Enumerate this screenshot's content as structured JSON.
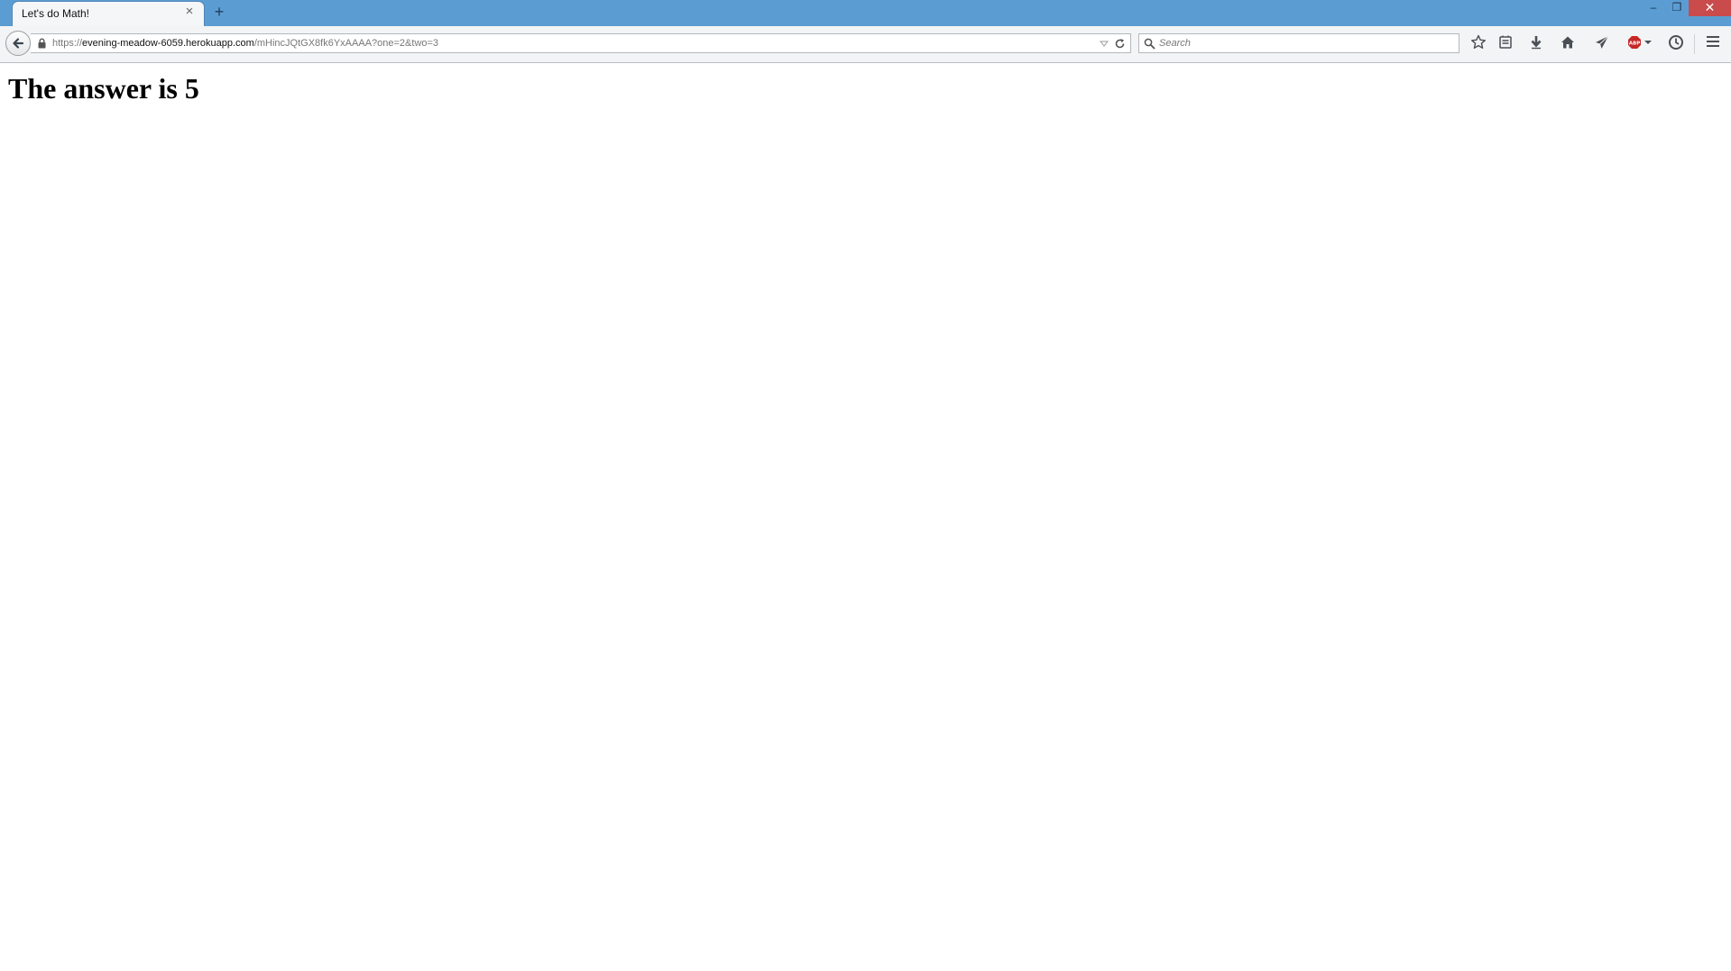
{
  "browser": {
    "tab": {
      "title": "Let's do Math!",
      "close_label": "×"
    },
    "new_tab_label": "+",
    "window_controls": {
      "minimize_label": "–",
      "restore_label": "❐",
      "close_label": "✕"
    },
    "address_bar": {
      "url_prefix": "https://",
      "url_host": "evening-meadow-6059.herokuapp.com",
      "url_path": "/mHincJQtGX8fk6YxAAAA?one=2&two=3"
    },
    "search_bar": {
      "placeholder": "Search"
    },
    "toolbar_icons": [
      "bookmark-star-icon",
      "reading-list-icon",
      "download-icon",
      "home-icon",
      "send-icon",
      "adblock-icon",
      "history-icon",
      "menu-icon"
    ],
    "colors": {
      "titlebar": "#5b9dd3",
      "close_button": "#c94b4b",
      "adblock_badge": "#c62828"
    }
  },
  "page": {
    "heading": "The answer is 5"
  }
}
